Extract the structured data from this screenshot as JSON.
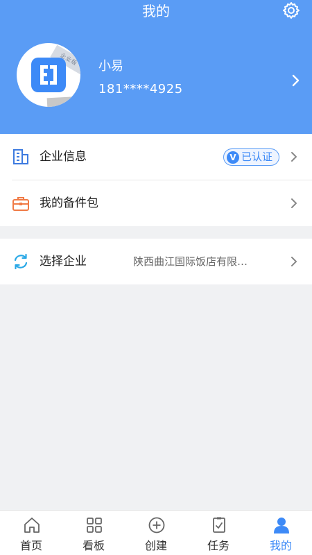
{
  "header": {
    "title": "我的",
    "user": {
      "name": "小易",
      "phone": "181****4925"
    },
    "avatar_tag": "企业版"
  },
  "menu": {
    "company_info": {
      "label": "企业信息",
      "badge": "已认证",
      "badge_mark": "V"
    },
    "spare_parts": {
      "label": "我的备件包"
    },
    "select_company": {
      "label": "选择企业",
      "value": "陕西曲江国际饭店有限…"
    }
  },
  "tabbar": {
    "items": [
      {
        "label": "首页",
        "icon": "home-icon"
      },
      {
        "label": "看板",
        "icon": "dashboard-icon"
      },
      {
        "label": "创建",
        "icon": "add-icon"
      },
      {
        "label": "任务",
        "icon": "task-icon"
      },
      {
        "label": "我的",
        "icon": "profile-icon",
        "active": true
      }
    ]
  },
  "colors": {
    "primary": "#5a9cf5",
    "accent": "#3d8af7",
    "background": "#f0f1f3"
  }
}
